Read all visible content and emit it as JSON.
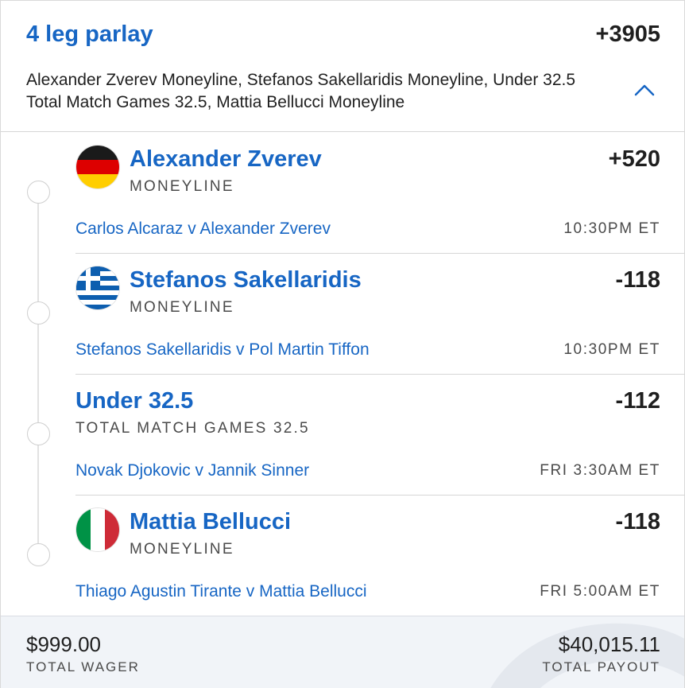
{
  "header": {
    "title": "4 leg parlay",
    "odds": "+3905",
    "description": "Alexander Zverev Moneyline, Stefanos Sakellaridis Moneyline, Under 32.5 Total Match Games 32.5, Mattia Bellucci Moneyline",
    "collapse_icon": "chevron-up-icon"
  },
  "legs": [
    {
      "selection": "Alexander Zverev",
      "market": "MONEYLINE",
      "odds": "+520",
      "event": "Carlos Alcaraz v Alexander Zverev",
      "time": "10:30PM ET",
      "flag": "germany-flag-icon"
    },
    {
      "selection": "Stefanos Sakellaridis",
      "market": "MONEYLINE",
      "odds": "-118",
      "event": "Stefanos Sakellaridis v Pol Martin Tiffon",
      "time": "10:30PM ET",
      "flag": "greece-flag-icon"
    },
    {
      "selection": "Under 32.5",
      "market": "TOTAL MATCH GAMES 32.5",
      "odds": "-112",
      "event": "Novak Djokovic v Jannik Sinner",
      "time": "FRI 3:30AM ET"
    },
    {
      "selection": "Mattia Bellucci",
      "market": "MONEYLINE",
      "odds": "-118",
      "event": "Thiago Agustin Tirante v Mattia Bellucci",
      "time": "FRI 5:00AM ET",
      "flag": "italy-flag-icon"
    }
  ],
  "footer": {
    "wager_amount": "$999.00",
    "wager_label": "TOTAL WAGER",
    "payout_amount": "$40,015.11",
    "payout_label": "TOTAL PAYOUT"
  },
  "colors": {
    "accent_blue": "#1766c4",
    "text_dark": "#1f1f1f",
    "footer_bg": "#f1f4f8"
  }
}
